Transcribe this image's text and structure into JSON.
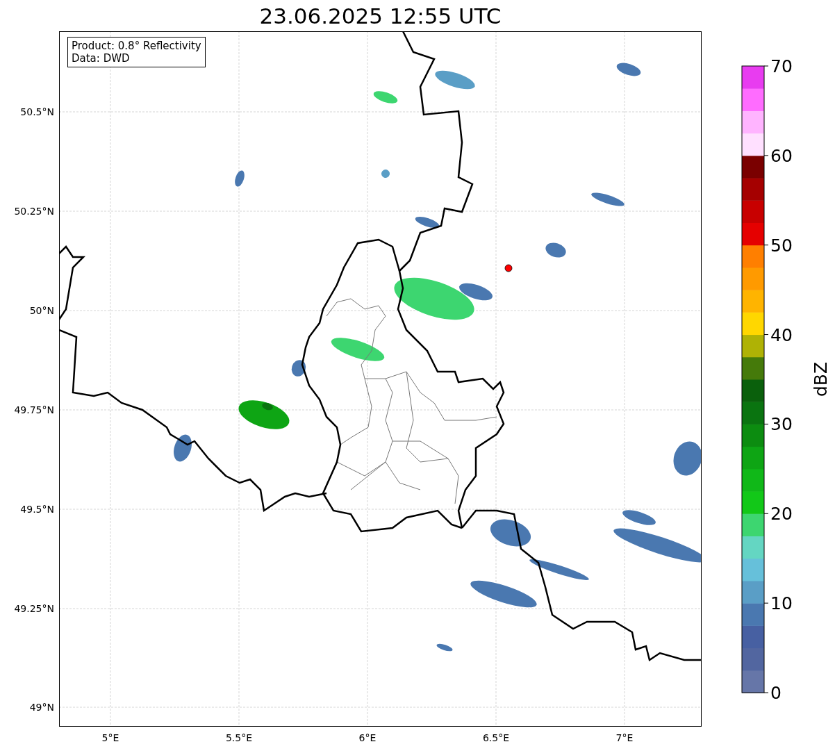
{
  "title": "23.06.2025 12:55 UTC",
  "info_box": {
    "lines": [
      "Product: 0.8° Reflectivity",
      "Data: DWD"
    ]
  },
  "y_ticks": [
    "50.5°N",
    "50.25°N",
    "50°N",
    "49.75°N",
    "49.5°N",
    "49.25°N",
    "49°N"
  ],
  "x_ticks": [
    "5°E",
    "5.5°E",
    "6°E",
    "6.5°E",
    "7°E"
  ],
  "colorbar": {
    "label": "dBZ",
    "ticks": [
      "70",
      "60",
      "50",
      "40",
      "30",
      "20",
      "10",
      "0"
    ],
    "steps": [
      {
        "color": "#6676a8"
      },
      {
        "color": "#5266a0"
      },
      {
        "color": "#4760a2"
      },
      {
        "color": "#4a78b0"
      },
      {
        "color": "#5a9ec6"
      },
      {
        "color": "#66c0da"
      },
      {
        "color": "#64d6c2"
      },
      {
        "color": "#3dd670"
      },
      {
        "color": "#12c818"
      },
      {
        "color": "#10b818"
      },
      {
        "color": "#0ea514"
      },
      {
        "color": "#0c8c10"
      },
      {
        "color": "#0a7410"
      },
      {
        "color": "#0a600c"
      },
      {
        "color": "#457a0a"
      },
      {
        "color": "#afb205"
      },
      {
        "color": "#ffd700"
      },
      {
        "color": "#ffb400"
      },
      {
        "color": "#ff9a00"
      },
      {
        "color": "#ff7f00"
      },
      {
        "color": "#e50000"
      },
      {
        "color": "#c80000"
      },
      {
        "color": "#a50000"
      },
      {
        "color": "#7a0000"
      },
      {
        "color": "#ffe0ff"
      },
      {
        "color": "#ffb4ff"
      },
      {
        "color": "#ff6cff"
      },
      {
        "color": "#e83cf0"
      }
    ]
  }
}
